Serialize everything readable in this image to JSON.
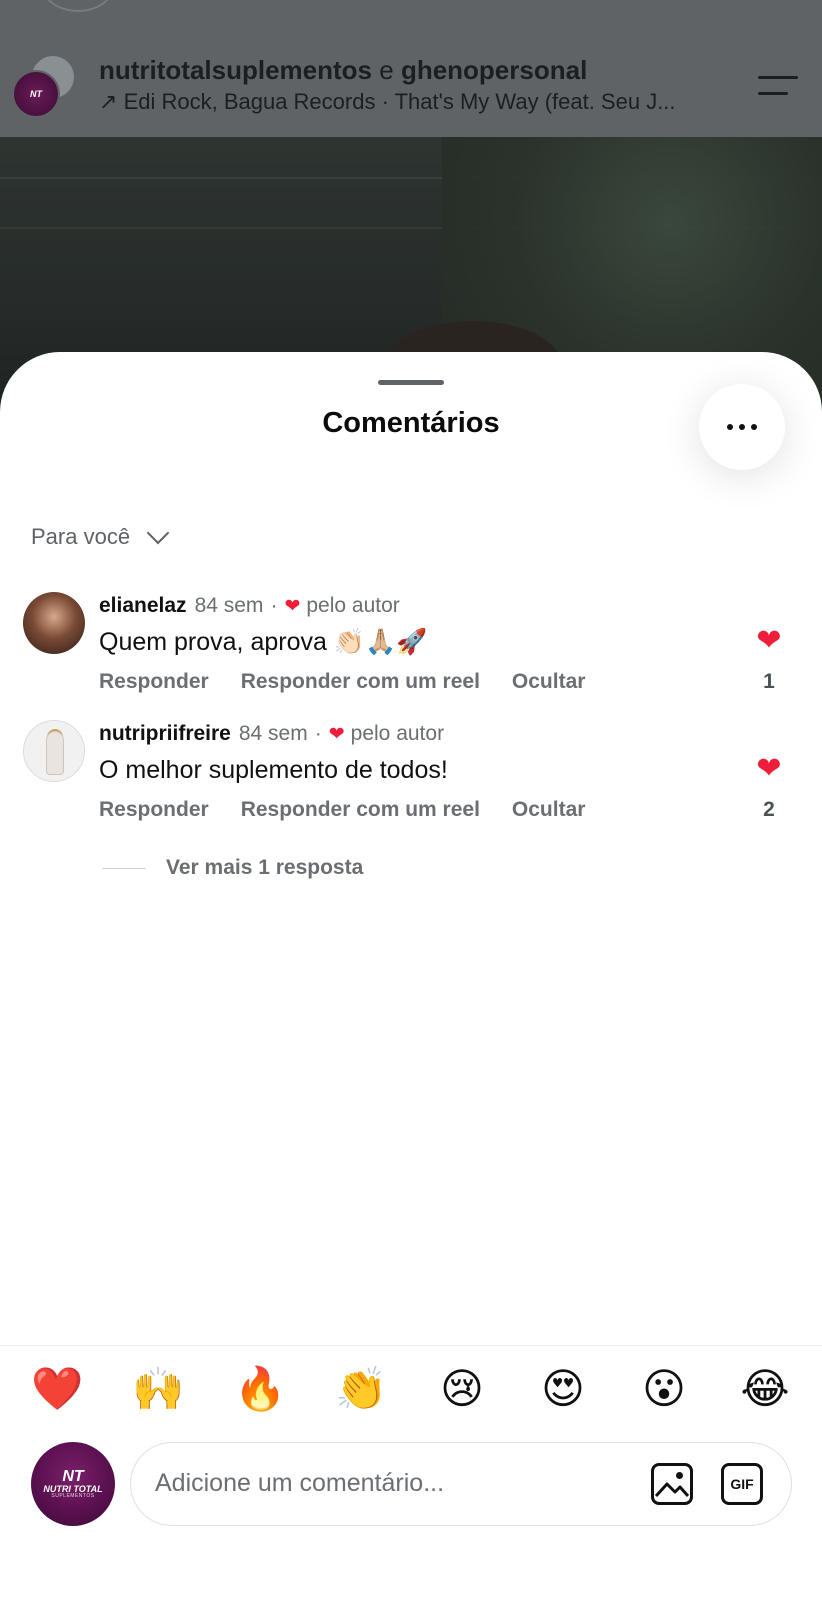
{
  "reel": {
    "owner_name_1": "nutritotalsuplementos",
    "owner_conj": " e ",
    "owner_name_2": "ghenopersonal",
    "music_arrow": "↗",
    "music_text": "Edi Rock, Bagua Records · That's My Way (feat. Seu J...",
    "avatar_logo_text": "NT"
  },
  "sheet": {
    "title": "Comentários",
    "more_glyph": "•••",
    "sort_label": "Para você"
  },
  "comments": [
    {
      "username": "elianelaz",
      "time": "84 sem",
      "separator": "·",
      "liked_by_author_heart": "❤",
      "liked_by_author_text": "pelo autor",
      "text": "Quem prova, aprova 👏🏻🙏🏼🚀",
      "actions": {
        "reply": "Responder",
        "reply_reel": "Responder com um reel",
        "hide": "Ocultar"
      },
      "like_icon": "❤",
      "like_count": "1"
    },
    {
      "username": "nutripriifreire",
      "time": "84 sem",
      "separator": "·",
      "liked_by_author_heart": "❤",
      "liked_by_author_text": "pelo autor",
      "text": "O melhor suplemento de todos!",
      "actions": {
        "reply": "Responder",
        "reply_reel": "Responder com um reel",
        "hide": "Ocultar"
      },
      "like_icon": "❤",
      "like_count": "2"
    }
  ],
  "more_replies": "Ver mais 1 resposta",
  "emoji_bar": [
    "❤️",
    "🙌",
    "🔥",
    "👏",
    "😢",
    "😍",
    "😮",
    "😂"
  ],
  "composer": {
    "avatar_line1": "NT",
    "avatar_line2": "NUTRI TOTAL",
    "avatar_line3": "SUPLEMENTOS",
    "placeholder": "Adicione um comentário...",
    "gif_label": "GIF"
  },
  "colors": {
    "like_red": "#ee1d3a",
    "muted_gray": "#6b6f73",
    "brand_purple": "#5a1050"
  }
}
